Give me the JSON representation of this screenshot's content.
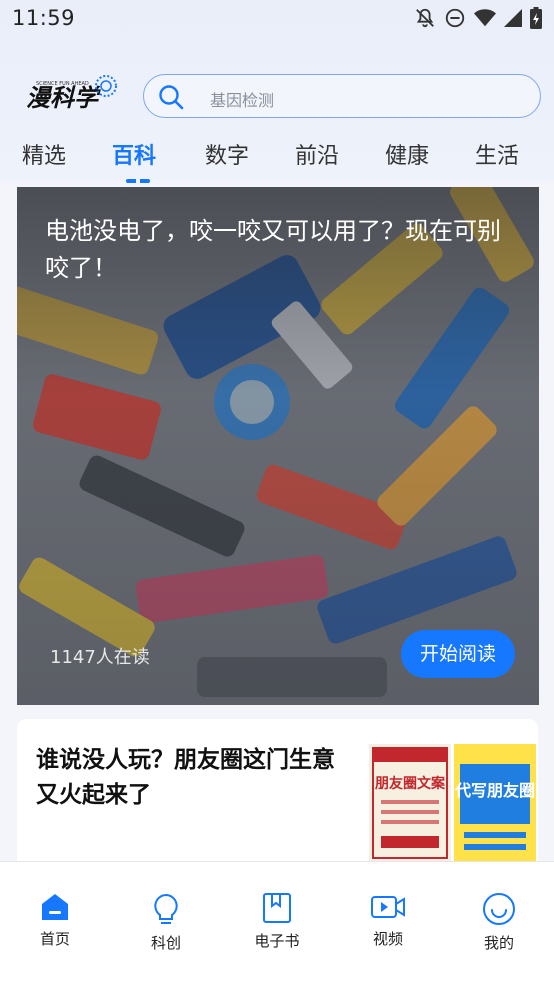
{
  "status_bar": {
    "time": "11:59"
  },
  "header": {
    "logo_text": "漫科学",
    "logo_subtext": "SCIENCE FUN AHEAD",
    "search_placeholder": "基因检测"
  },
  "tabs": [
    {
      "label": "精选",
      "active": false
    },
    {
      "label": "百科",
      "active": true
    },
    {
      "label": "数字",
      "active": false
    },
    {
      "label": "前沿",
      "active": false
    },
    {
      "label": "健康",
      "active": false
    },
    {
      "label": "生活",
      "active": false
    }
  ],
  "hero_card": {
    "title": "电池没电了，咬一咬又可以用了？现在可别咬了！",
    "readers": "1147人在读",
    "button_label": "开始阅读"
  },
  "article_card": {
    "title": "谁说没人玩？朋友圈这门生意又火起来了",
    "thumb1_text": "朋友圈文案",
    "thumb2_text": "代写朋友圈"
  },
  "bottom_nav": [
    {
      "label": "首页",
      "icon": "home-icon",
      "active": true
    },
    {
      "label": "科创",
      "icon": "lightbulb-icon",
      "active": false
    },
    {
      "label": "电子书",
      "icon": "book-icon",
      "active": false
    },
    {
      "label": "视频",
      "icon": "video-icon",
      "active": false
    },
    {
      "label": "我的",
      "icon": "profile-icon",
      "active": false
    }
  ],
  "colors": {
    "accent": "#1677ff"
  }
}
